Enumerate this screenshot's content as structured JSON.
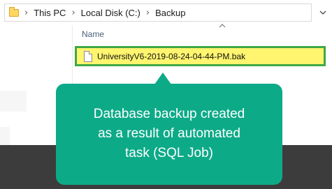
{
  "address_bar": {
    "crumbs": [
      "This PC",
      "Local Disk (C:)",
      "Backup"
    ]
  },
  "file_list": {
    "column_header": "Name",
    "files": [
      {
        "name": "UniversityV6-2019-08-24-04-44-PM.bak",
        "highlighted": true
      }
    ]
  },
  "callout": {
    "lines": [
      "Database backup created",
      "as a result of automated",
      "task (SQL Job)"
    ]
  },
  "colors": {
    "callout_bg": "#0daa88",
    "highlight_fill": "#fff56f",
    "highlight_border": "#3fa845",
    "taskbar": "#3c3c3c"
  },
  "icons": [
    "folder-icon",
    "chevron-right-icon",
    "chevron-down-icon",
    "sort-up-icon",
    "file-icon"
  ]
}
